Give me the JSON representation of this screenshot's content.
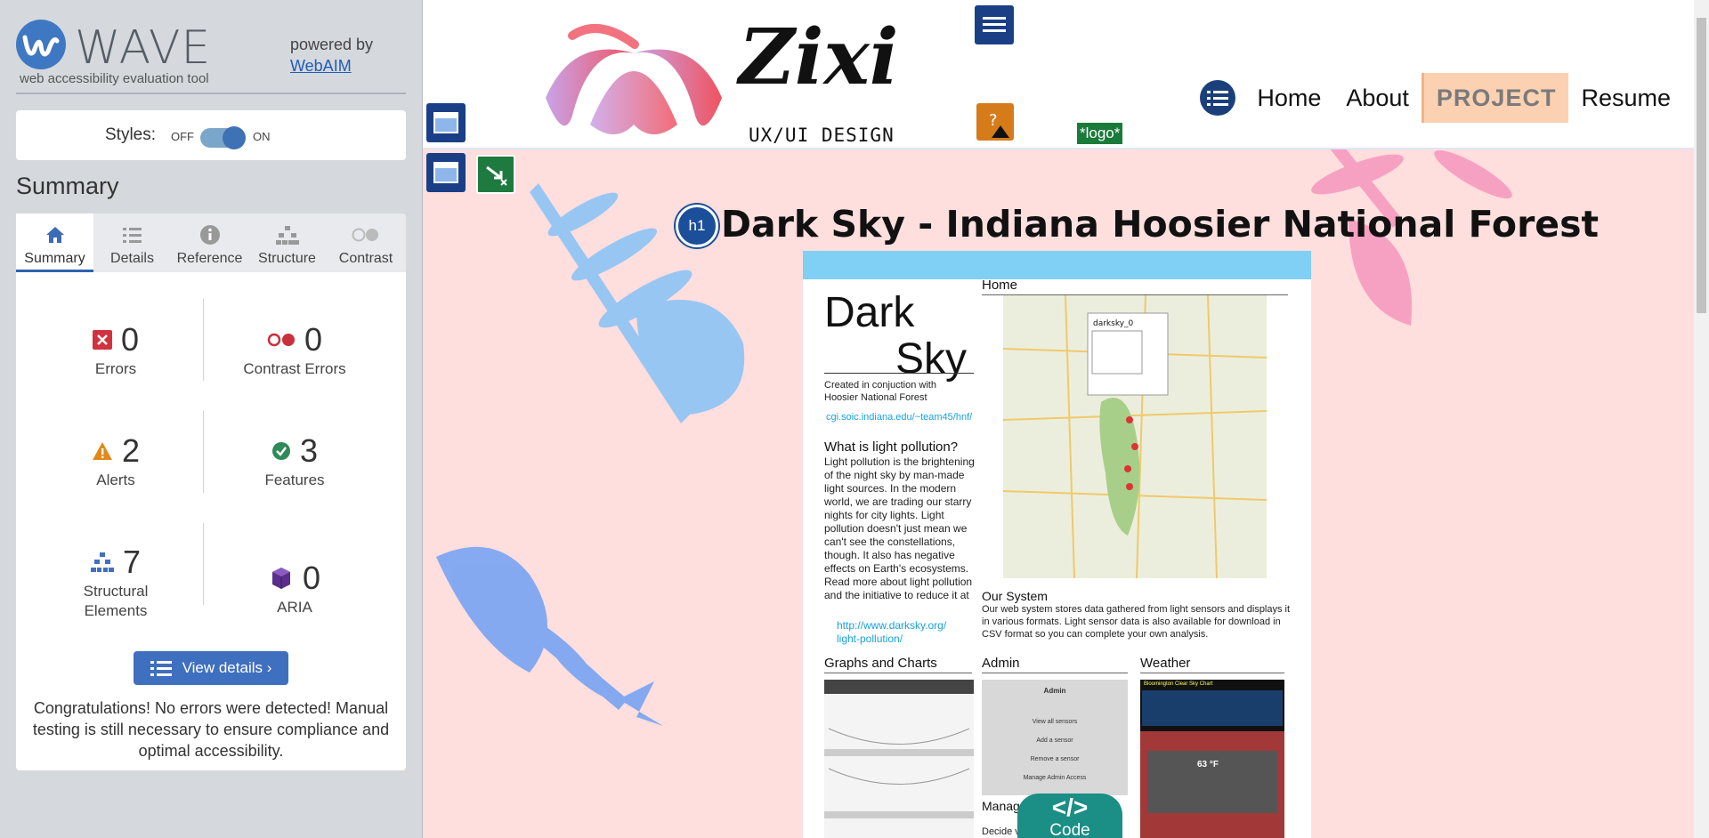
{
  "wave": {
    "brand": "WAVE",
    "tagline": "web accessibility evaluation tool",
    "powered_by": "powered by",
    "webaim_link": "WebAIM",
    "styles_label": "Styles:",
    "styles_off": "OFF",
    "styles_on": "ON",
    "summary_heading": "Summary",
    "tabs": [
      {
        "label": "Summary",
        "icon": "home-icon"
      },
      {
        "label": "Details",
        "icon": "list-icon"
      },
      {
        "label": "Reference",
        "icon": "info-icon"
      },
      {
        "label": "Structure",
        "icon": "hierarchy-icon"
      },
      {
        "label": "Contrast",
        "icon": "contrast-icon"
      }
    ],
    "stats": {
      "errors": {
        "value": "0",
        "label": "Errors"
      },
      "contrast_errors": {
        "value": "0",
        "label": "Contrast Errors"
      },
      "alerts": {
        "value": "2",
        "label": "Alerts"
      },
      "features": {
        "value": "3",
        "label": "Features"
      },
      "structural": {
        "value": "7",
        "label_1": "Structural",
        "label_2": "Elements"
      },
      "aria": {
        "value": "0",
        "label": "ARIA"
      }
    },
    "view_details": "View details ›",
    "congrats": "Congratulations! No errors were detected! Manual testing is still necessary to ensure compliance and optimal accessibility."
  },
  "site": {
    "logo_word": "Zixi",
    "logo_sub": "UX/UI DESIGN",
    "logo_alt_badge": "*logo*",
    "nav": [
      "Home",
      "About",
      "PROJECT",
      "Resume"
    ],
    "page_title": "Dark Sky - Indiana Hoosier National Forest",
    "h1_badge": "h1",
    "code_button": "Code",
    "code_symbol": "</>"
  },
  "shot": {
    "title_1": "Dark",
    "title_2": "Sky",
    "created": "Created in conjuction with Hoosier National Forest",
    "url": "cgi.soic.indiana.edu/~team45/hnf/",
    "what_heading": "What is light pollution?",
    "body": "Light pollution is the brightening of the night sky by man-made light sources. In the modern world, we are trading our starry nights for city lights. Light pollution doesn't just mean we can't see the constellations, though. It also has negative effects on Earth's ecosystems. Read more about light pollution and the initiative to reduce it at",
    "body_link_1": "http://www.darksky.org/",
    "body_link_2": "light-pollution/",
    "home_heading": "Home",
    "our_system_heading": "Our System",
    "our_system_body": "Our web system stores data gathered from light sensors and displays it in various formats. Light sensor data is also available for download in CSV format so you can complete your own analysis.",
    "graphs_heading": "Graphs and Charts",
    "admin_heading": "Admin",
    "weather_heading": "Weather",
    "admin_panel_title": "Admin",
    "admin_items": [
      "View all sensors",
      "Add a sensor",
      "Remove a sensor",
      "Manage Admin Access"
    ],
    "manage_heading": "Manag",
    "decide_text": "Decide v",
    "map_popup_title": "darksky_0",
    "weather_title": "Bloomington Clear Sky Chart",
    "weather_temp": "63 °F"
  }
}
